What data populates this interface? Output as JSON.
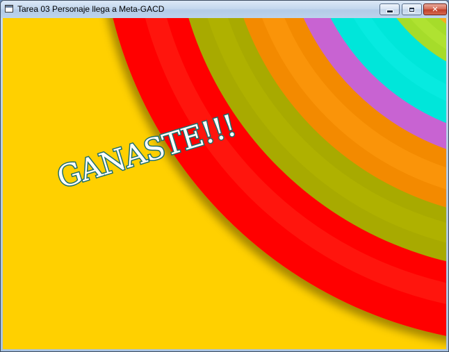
{
  "window": {
    "title": "Tarea 03 Personaje llega a Meta-GACD",
    "icon": "app-window-icon",
    "controls": {
      "minimize_icon": "minimize-icon",
      "maximize_icon": "maximize-icon",
      "close_icon": "close-icon",
      "close_glyph": "✕"
    }
  },
  "scene": {
    "message": "GANASTE!!!",
    "message_fill": "#ffffff",
    "message_outline": "#1d6e6c",
    "background_colors": [
      "#ff3b3b",
      "#ff9d00",
      "#a9d628",
      "#00e6dc",
      "#c85fd0",
      "#f08a00",
      "#a5a800",
      "#ff0000",
      "#ffcf00"
    ]
  }
}
